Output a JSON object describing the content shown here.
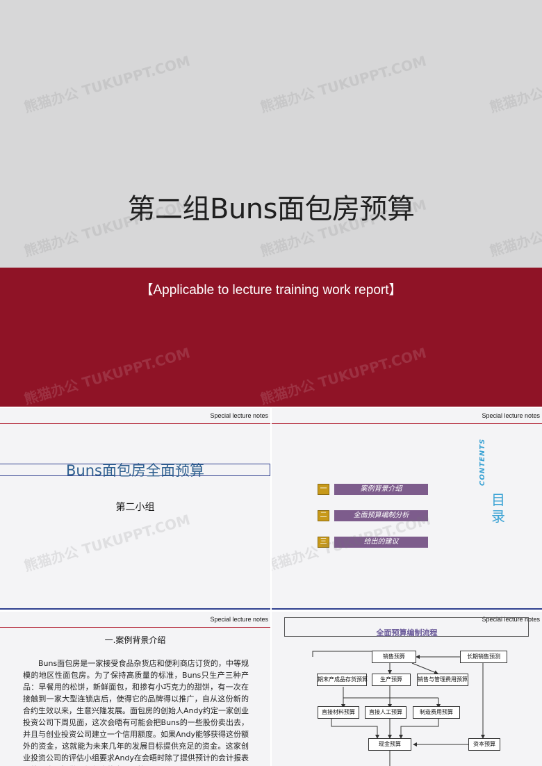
{
  "cover": {
    "title": "第二组Buns面包房预算",
    "subtitle": "【Applicable to lecture training work report】"
  },
  "watermark": "熊猫办公 TUKUPPT.COM",
  "slide_note": "Special lecture notes",
  "slide1": {
    "title": "Buns面包房全面预算",
    "subtitle": "第二小组"
  },
  "slide2": {
    "items": [
      {
        "num": "一",
        "label": "案例背景介绍"
      },
      {
        "num": "二",
        "label": "全面预算编制分析"
      },
      {
        "num": "三",
        "label": "给出的建议"
      }
    ],
    "contents_label": "CONTENTS",
    "mulu": "目录"
  },
  "slide3": {
    "heading": "一.案例背景介绍",
    "body": "Buns面包房是一家接受食品杂货店和便利商店订货的，中等规模的地区性面包房。为了保持高质量的标准，Buns只生产三种产品：早餐用的松饼，新鲜面包，和掺有小巧克力的甜饼，有一次在接触到一家大型连锁店后，使得它的品牌得以推广，自从这份新的合约生效以来，生意兴隆发展。面包房的创始人Andy约定一家创业投资公司下周见面，这次会晤有可能会把Buns的一些股份卖出去，并且与创业投资公司建立一个信用额度。如果Andy能够获得这份额外的资金，这就能为未来几年的发展目标提供充足的资金。这家创业投资公司的评估小组要求Andy在会晤时除了提供预计的会计报表以外，也要提供一份年度的全面预算。"
  },
  "slide4": {
    "title": "全面预算编制流程",
    "boxes": {
      "sales": "销售预算",
      "longterm": "长期销售预测",
      "ending_inv": "期末产成品存货预算",
      "production": "生产预算",
      "selling_admin": "销售与管理费用预算",
      "materials": "直接材料预算",
      "labor": "直接人工预算",
      "overhead": "制造费用预算",
      "cash": "现金预算",
      "capital": "资本预算"
    }
  }
}
